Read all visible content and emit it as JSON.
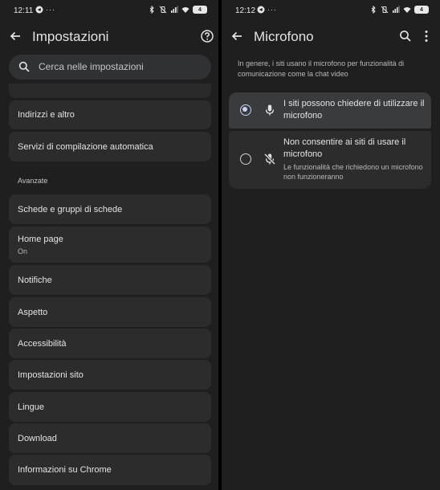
{
  "left_screen": {
    "status": {
      "time": "12:11",
      "battery": "4"
    },
    "title": "Impostazioni",
    "search_placeholder": "Cerca nelle impostazioni",
    "items": [
      {
        "label": "Indirizzi e altro"
      },
      {
        "label": "Servizi di compilazione automatica"
      },
      {
        "label": "Schede e gruppi di schede"
      },
      {
        "label": "Home page",
        "sub": "On"
      },
      {
        "label": "Notifiche"
      },
      {
        "label": "Aspetto"
      },
      {
        "label": "Accessibilità"
      },
      {
        "label": "Impostazioni sito"
      },
      {
        "label": "Lingue"
      },
      {
        "label": "Download"
      },
      {
        "label": "Informazioni su Chrome"
      }
    ],
    "section_label": "Avanzate",
    "icons": {
      "back": "back-arrow-icon",
      "help": "help-icon",
      "search": "search-icon"
    }
  },
  "right_screen": {
    "status": {
      "time": "12:12",
      "battery": "4"
    },
    "title": "Microfono",
    "description": "In genere, i siti usano il microfono per funzionalità di comunicazione come la chat video",
    "options": [
      {
        "title": "I siti possono chiedere di utilizzare il microfono",
        "selected": true,
        "icon": "mic-icon"
      },
      {
        "title": "Non consentire ai siti di usare il microfono",
        "sub": "Le funzionalità che richiedono un microfono non funzioneranno",
        "selected": false,
        "icon": "mic-off-icon"
      }
    ],
    "icons": {
      "back": "back-arrow-icon",
      "search": "search-icon",
      "more": "more-vert-icon"
    }
  },
  "colors": {
    "background": "#1f1f1f",
    "item": "#2c2c2d",
    "selected": "#3a3b3c",
    "accent": "#c5d3f5"
  }
}
